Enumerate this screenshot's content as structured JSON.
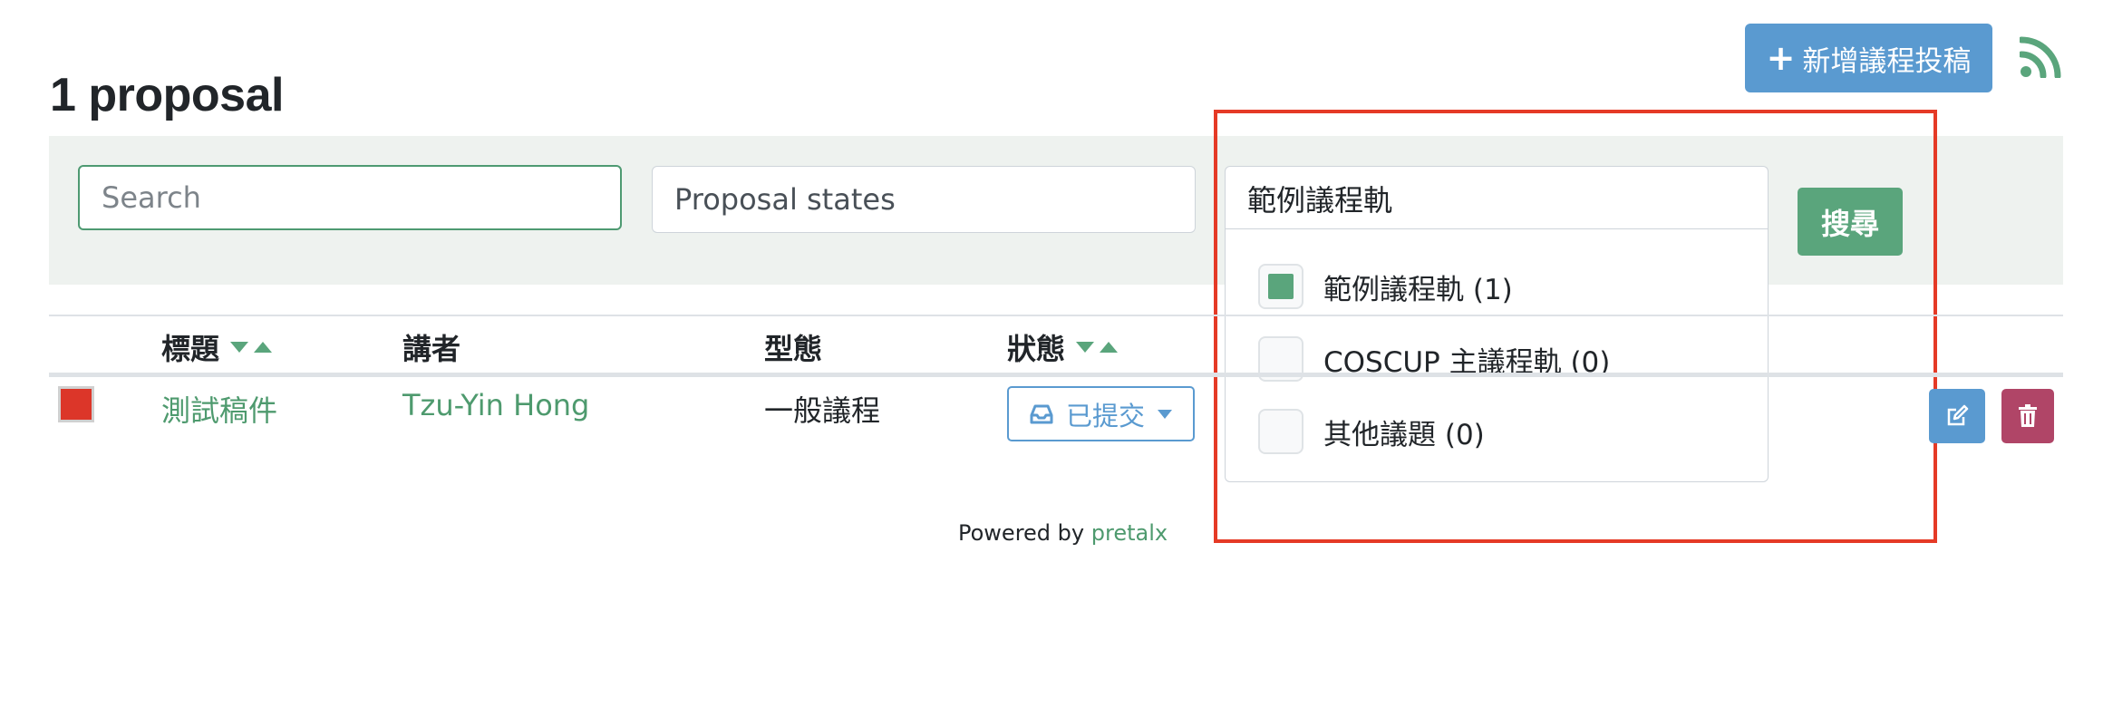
{
  "header": {
    "title": "1 proposal",
    "new_button_label": "新增議程投稿",
    "new_button_icon": "plus-icon",
    "feed_icon": "rss-icon"
  },
  "filters": {
    "search_placeholder": "Search",
    "states_placeholder": "Proposal states",
    "track_selected": "範例議程軌",
    "track_options": [
      {
        "label": "範例議程軌 (1)",
        "checked": true
      },
      {
        "label": "COSCUP 主議程軌 (0)",
        "checked": false
      },
      {
        "label": "其他議題 (0)",
        "checked": false
      }
    ],
    "search_button": "搜尋"
  },
  "table": {
    "headers": {
      "title": "標題",
      "speaker": "講者",
      "type": "型態",
      "state": "狀態"
    },
    "rows": [
      {
        "color": "#dc3629",
        "title": "測試稿件",
        "speaker": "Tzu-Yin Hong",
        "type": "一般議程",
        "state": "已提交",
        "state_icon": "inbox-icon"
      }
    ]
  },
  "footer": {
    "prefix": "Powered by",
    "link": "pretalx"
  },
  "colors": {
    "accent_green": "#5aa57c",
    "primary_blue": "#5a9ad0",
    "danger": "#b04567",
    "highlight": "#e53a26"
  }
}
